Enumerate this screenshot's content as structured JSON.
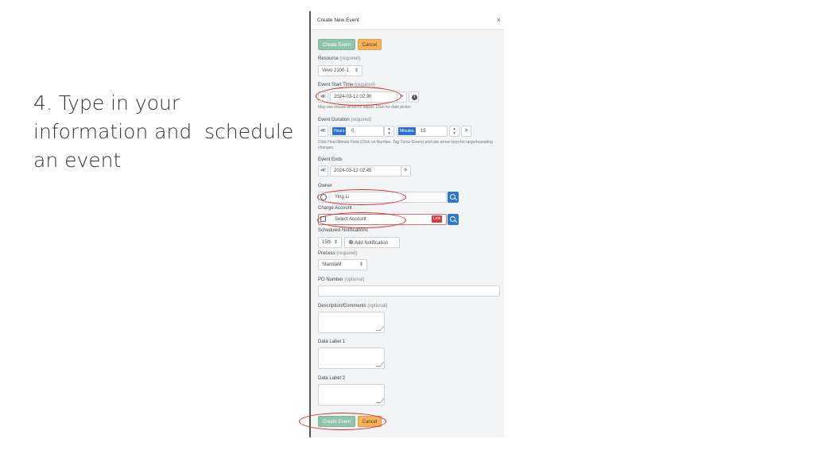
{
  "slide": {
    "lines": [
      "4. Type in your",
      "information and  schedule",
      "an event"
    ]
  },
  "dialog": {
    "title": "Create New Event",
    "close_glyph": "×",
    "top_buttons": {
      "create": "Create Event",
      "cancel": "Cancel"
    },
    "resource": {
      "label": "Resource",
      "required": "(required)",
      "value": "Vevo 2100-1",
      "caret": "⇕"
    },
    "start_time": {
      "label": "Event Start Time",
      "required": "(required)",
      "value": "2024-03-12 02:30",
      "hint": "May use mouse wheel to adjust. Click for date picker.",
      "prev_glyph": "≪",
      "next_glyph": ">",
      "info_glyph": "i"
    },
    "duration": {
      "label": "Event Duration",
      "required": "(required)",
      "hours_tag": "Hours",
      "hours_value": "0",
      "minutes_tag": "Minutes",
      "minutes_value": "15",
      "hint": "Click Hour/Minute Field (Click on Number. Tag Turns Green) and use arrow keys for large/repeating changes.",
      "prev_glyph": "≪",
      "next_glyph": ">"
    },
    "event_ends": {
      "label": "Event Ends",
      "value": "2024-03-12 02:45",
      "prev_glyph": "≪",
      "next_glyph": ">"
    },
    "owner": {
      "label": "Owner",
      "value": "Ying Li"
    },
    "charge_account": {
      "label": "Charge Account",
      "value": "Select Account",
      "badge": "Link"
    },
    "notifications": {
      "label": "Scheduled Notifications",
      "interval": "15m",
      "add_label": "Add Notification",
      "add_glyph": "⊕"
    },
    "process": {
      "label": "Process",
      "required": "(required)",
      "value": "Standard"
    },
    "po_number": {
      "label": "PO Number",
      "optional": "(optional)",
      "value": ""
    },
    "description": {
      "label": "Description/Comments",
      "optional": "(optional)"
    },
    "data_label_1": {
      "label": "Data Label 1"
    },
    "data_label_2": {
      "label": "Data Label 2"
    },
    "bottom_buttons": {
      "create": "Create Event",
      "cancel": "Cancel"
    }
  },
  "colors": {
    "accent_green": "#8fc6a9",
    "accent_orange": "#f7b25a",
    "primary_blue": "#2b78d0",
    "annotation_red": "#d62a2a"
  }
}
